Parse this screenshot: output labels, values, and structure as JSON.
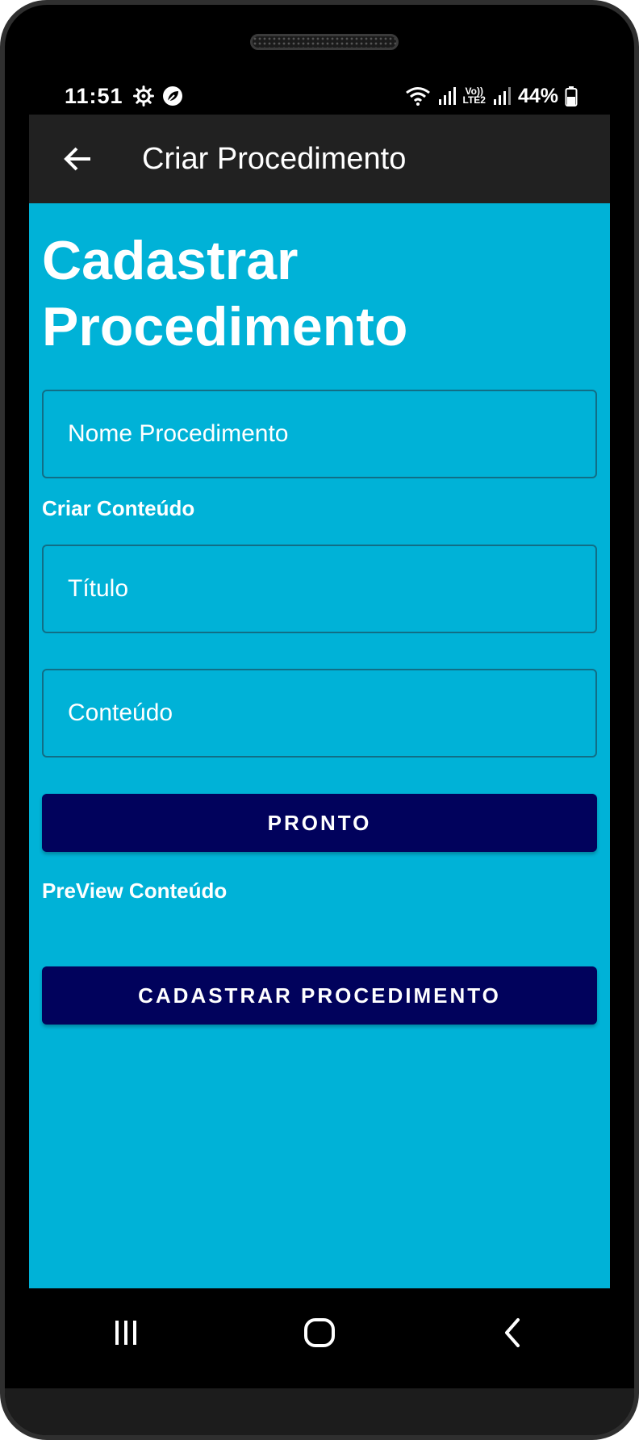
{
  "status_bar": {
    "time": "11:51",
    "battery": "44%",
    "network_label_top": "Vo))",
    "network_label_bottom": "LTE2"
  },
  "app_bar": {
    "title": "Criar Procedimento",
    "back_icon": "arrow-left-icon"
  },
  "main": {
    "heading": "Cadastrar Procedimento",
    "nome_placeholder": "Nome Procedimento",
    "criar_conteudo_label": "Criar Conteúdo",
    "titulo_placeholder": "Título",
    "conteudo_placeholder": "Conteúdo",
    "pronto_button": "PRONTO",
    "preview_label": "PreView Conteúdo",
    "cadastrar_button": "CADASTRAR PROCEDIMENTO"
  },
  "nav_bar": {
    "items": [
      "recents-icon",
      "home-icon",
      "back-icon"
    ]
  },
  "colors": {
    "background": "#00b2d7",
    "app_bar": "#212121",
    "button": "#01025c",
    "field_border": "#116e86"
  }
}
